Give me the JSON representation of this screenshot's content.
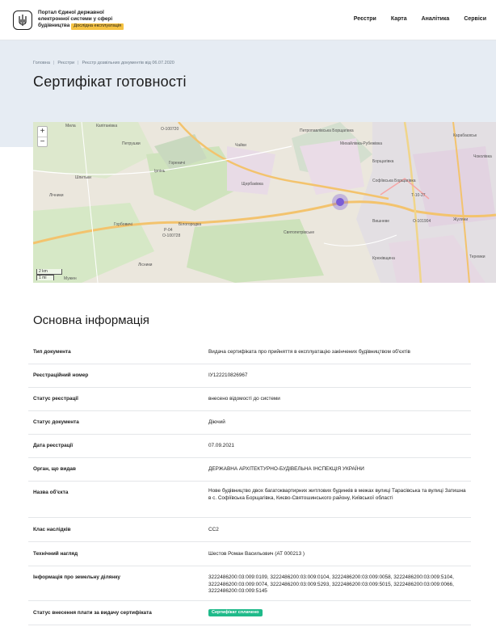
{
  "header": {
    "brand_line1": "Портал Єдиної державної",
    "brand_line2": "електронної системи у сфері",
    "brand_line3": "будівництва",
    "beta_label": "Дослідна експлуатація",
    "nav": [
      "Реєстри",
      "Карта",
      "Аналітика",
      "Сервіси"
    ]
  },
  "breadcrumb": [
    "Головна",
    "Реєстри",
    "Реєстр дозвільних документів від 06.07.2020"
  ],
  "page_title": "Сертифікат готовності",
  "map": {
    "zoom_in": "+",
    "zoom_out": "−",
    "scale_km": "2 km",
    "scale_mi": "1 mi",
    "labels": [
      "Мила",
      "Капітанівка",
      "О-100720",
      "Чайки",
      "Петропавлівська Борщагівка",
      "Михайлівка-Рубежівка",
      "Гореничі",
      "Ірпінь",
      "Петрушки",
      "Борщагівка",
      "Карабаєвськ",
      "Шпитьки",
      "Щербаківка",
      "Софіївська Борщагівка",
      "Т-10-27",
      "Лічники",
      "Вишневе",
      "Жуляни",
      "Горбовичі",
      "Білогородка",
      "О-101904",
      "Р-04",
      "О-100728",
      "Святопетрівське",
      "Крюківщина",
      "Лісники",
      "Мужен",
      "Теремки",
      "Чоколівка"
    ],
    "accent": "#7b5cd6"
  },
  "section_title": "Основна інформація",
  "info": [
    {
      "k": "Тип документа",
      "v": "Видача сертифіката про прийняття в експлуатацію закінчених будівництвом об'єктів"
    },
    {
      "k": "Реєстраційний номер",
      "v": "ІУ122210826967"
    },
    {
      "k": "Статус реєстрації",
      "v": "внесено відомості до системи"
    },
    {
      "k": "Статус документа",
      "v": "Діючий"
    },
    {
      "k": "Дата реєстрації",
      "v": "07.09.2021"
    },
    {
      "k": "Орган, що видав",
      "v": "ДЕРЖАВНА АРХІТЕКТУРНО-БУДІВЕЛЬНА ІНСПЕКЦІЯ УКРАЇНИ"
    },
    {
      "k": "Назва об'єкта",
      "v": "Нове будівництво двох багатоквартирних житлових будинків в межах вулиці Тарасівська та вулиці Затишна в с. Софіївська Борщагівка, Києво-Святошинського району, Київської області"
    },
    {
      "k": "Клас наслідків",
      "v": "СС2"
    },
    {
      "k": "Технічний нагляд",
      "v": "Шестов Роман Васильович (АТ 000213 )"
    },
    {
      "k": "Інформація про земельну ділянку",
      "v": "3222486200:03:009:0109, 3222486200:03:009:0104, 3222486200:03:009:0058, 3222486200:03:009:5104, 3222486200:03:009:0074, 3222486200:03:009:5293, 3222486200:03:009:5015, 3222486200:03:009:0066, 3222486200:03:009:5145"
    },
    {
      "k": "Статус внесення плати за видачу сертифіката",
      "v": "Сертифікат сплачено"
    }
  ],
  "colors": {
    "hero_bg": "#e6ecf3",
    "badge": "#1fba8a",
    "beta": "#f5c242"
  }
}
